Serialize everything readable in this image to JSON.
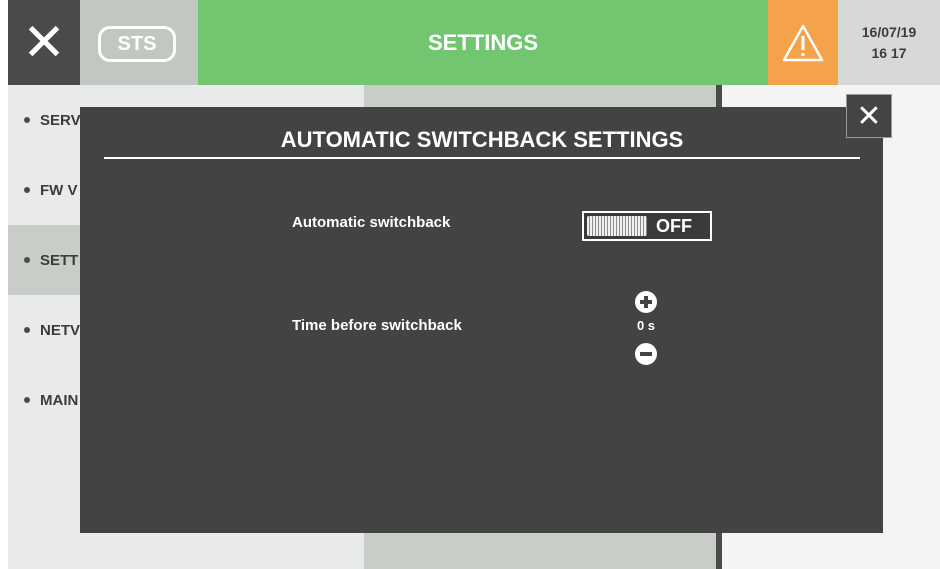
{
  "header": {
    "close_icon": "close-icon",
    "sts_label": "STS",
    "title": "SETTINGS",
    "alarm_icon": "warning-triangle-icon",
    "date": "16/07/19",
    "time": "16 17",
    "colors": {
      "title_bg": "#72c66f",
      "alarm_bg": "#f5a34a",
      "close_bg": "#4a4a4a"
    }
  },
  "sidebar": {
    "items": [
      {
        "label": "SERV"
      },
      {
        "label": "FW V"
      },
      {
        "label": "SETT"
      },
      {
        "label": "NETV"
      },
      {
        "label": "MAIN"
      }
    ],
    "active_index": 2
  },
  "modal": {
    "title": "AUTOMATIC SWITCHBACK SETTINGS",
    "close_icon": "close-icon",
    "switchback_label": "Automatic switchback",
    "switchback_state": "OFF",
    "time_label": "Time before switchback",
    "time_value": "0 s",
    "increment_icon": "plus-circle-icon",
    "decrement_icon": "minus-circle-icon"
  }
}
